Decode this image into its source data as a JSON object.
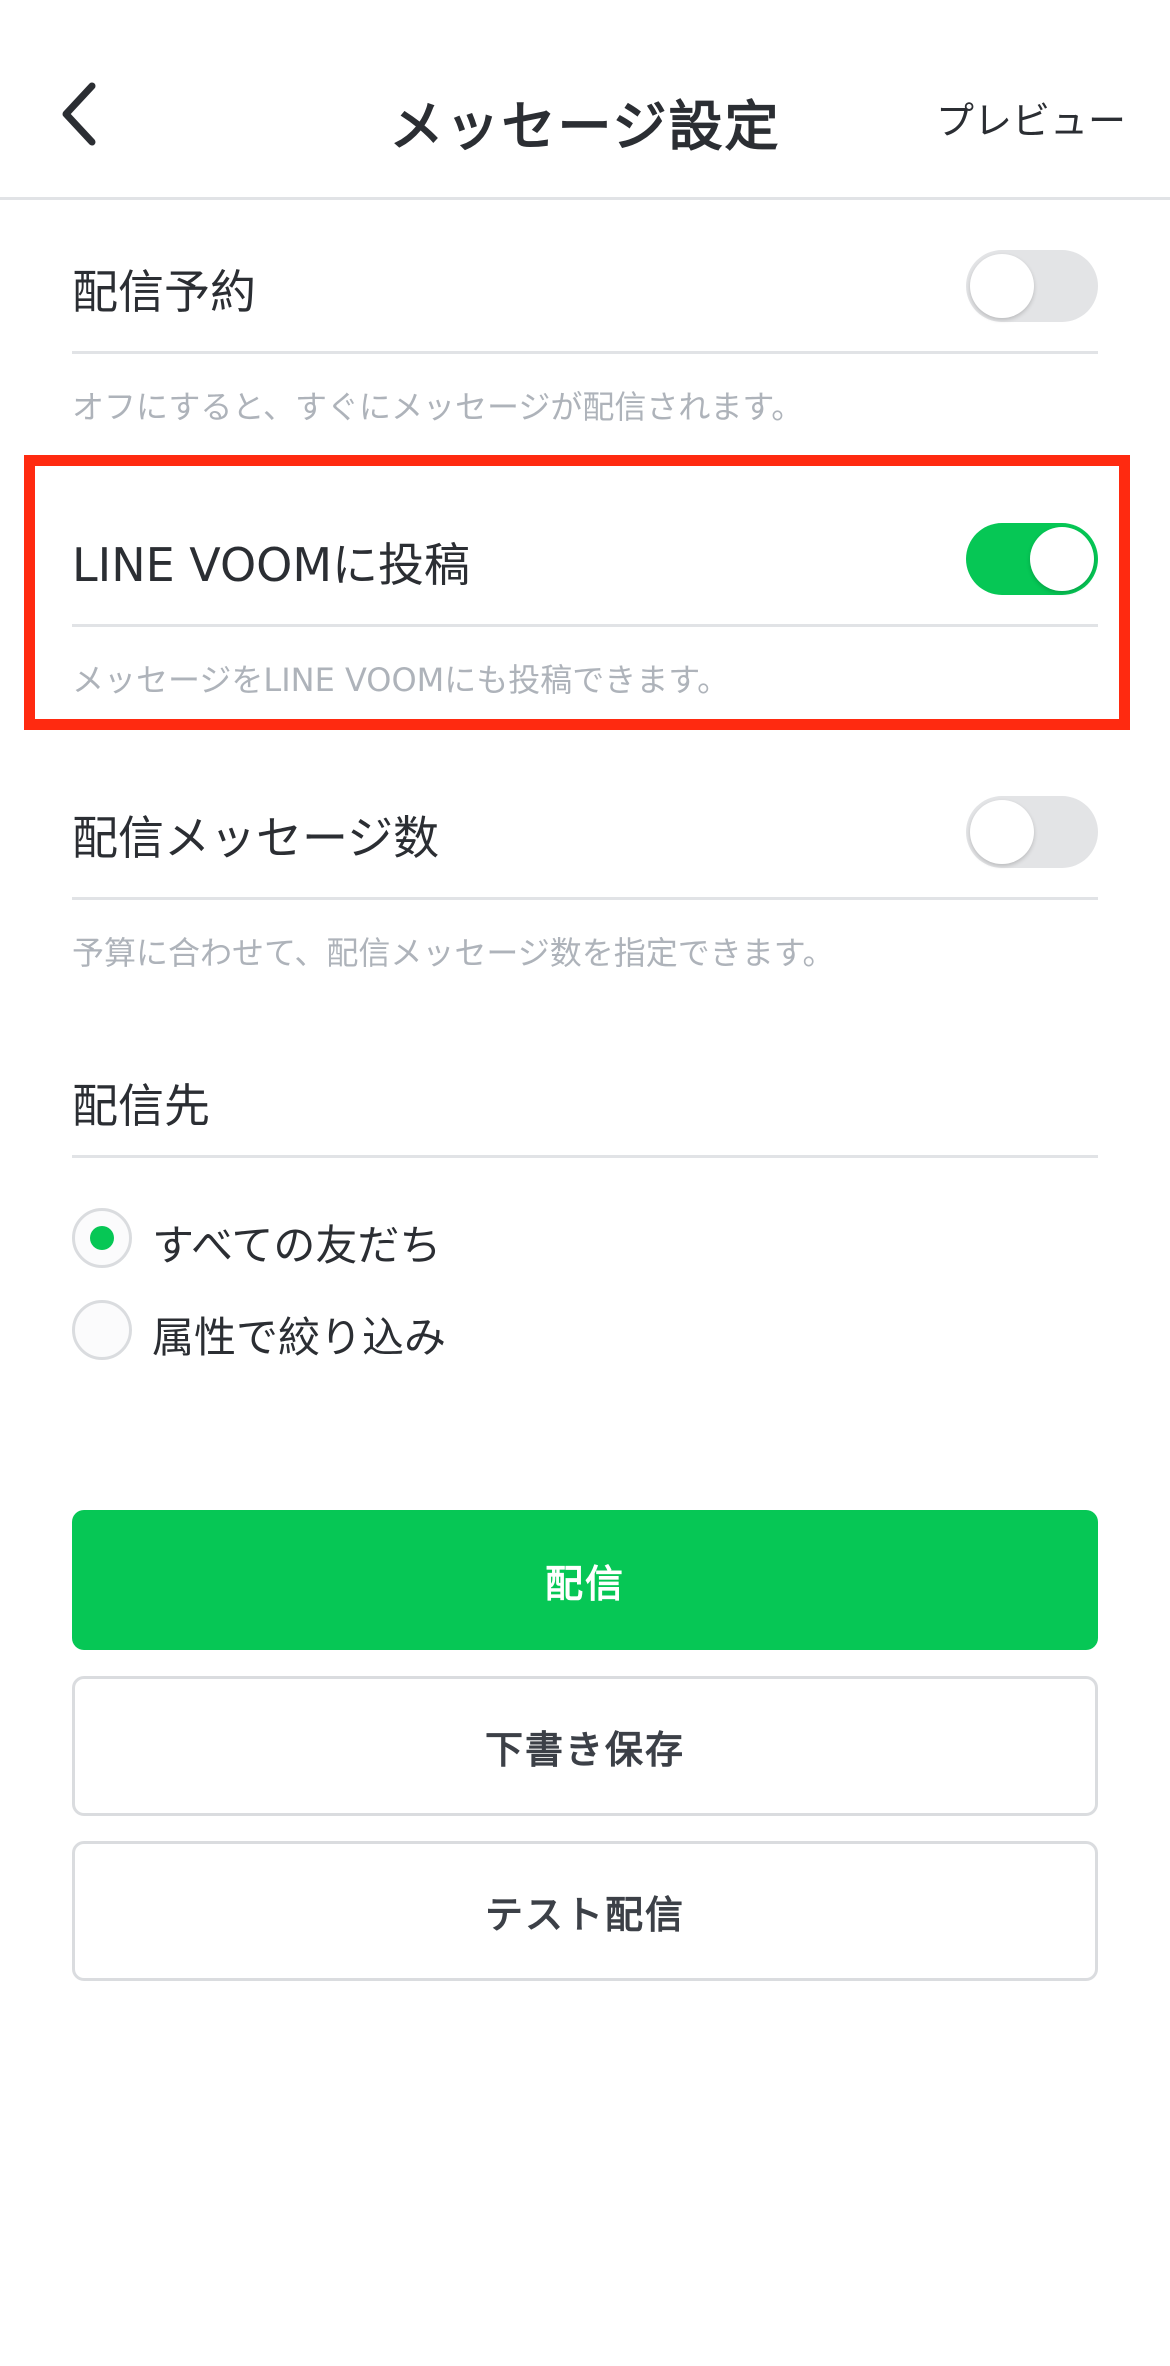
{
  "header": {
    "title": "メッセージ設定",
    "preview_label": "プレビュー"
  },
  "settings": {
    "schedule": {
      "label": "配信予約",
      "description": "オフにすると、すぐにメッセージが配信されます。",
      "toggle": "off"
    },
    "voom": {
      "label": "LINE VOOMに投稿",
      "description": "メッセージをLINE VOOMにも投稿できます。",
      "toggle": "on"
    },
    "message_count": {
      "label": "配信メッセージ数",
      "description": "予算に合わせて、配信メッセージ数を指定できます。",
      "toggle": "off"
    }
  },
  "recipients": {
    "label": "配信先",
    "options": [
      {
        "label": "すべての友だち",
        "selected": true
      },
      {
        "label": "属性で絞り込み",
        "selected": false
      }
    ]
  },
  "buttons": {
    "send": "配信",
    "save_draft": "下書き保存",
    "test_send": "テスト配信"
  },
  "colors": {
    "accent": "#06c755",
    "highlight": "#ff2a10",
    "muted_text": "#aeb3ba"
  }
}
